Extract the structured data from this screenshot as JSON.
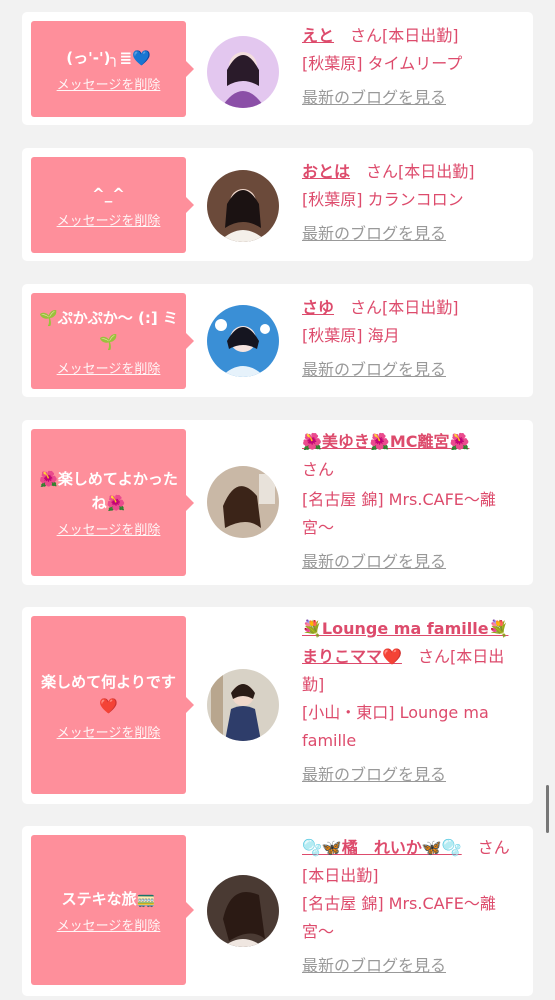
{
  "common": {
    "delete_label": "メッセージを削除",
    "blog_label": "最新のブログを見る",
    "san": "さん"
  },
  "items": [
    {
      "message": "(っ'-')╮≣💙",
      "name": "えと",
      "status": "[本日出勤]",
      "shop": "[秋葉原] タイムリープ"
    },
    {
      "message": "^_^",
      "name": "おとは",
      "status": "[本日出勤]",
      "shop": "[秋葉原] カランコロン"
    },
    {
      "message": "🌱ぷかぷか〜 (:] ミ🌱",
      "name": "さゆ",
      "status": "[本日出勤]",
      "shop": "[秋葉原] 海月"
    },
    {
      "message": "🌺楽しめてよかったね🌺",
      "name": "🌺美ゆき🌺MC離宮🌺",
      "status": "",
      "shop": "[名古屋 錦] Mrs.CAFE〜離宮〜"
    },
    {
      "message": "楽しめて何よりです❤️",
      "name": "💐Lounge ma famille💐まりこママ❤️",
      "status": "[本日出勤]",
      "shop": "[小山・東口] Lounge ma famille"
    },
    {
      "message": "ステキな旅🚃",
      "name": "🫧🦋橘　れいか🦋🫧",
      "status": "[本日出勤]",
      "shop": "[名古屋 錦] Mrs.CAFE〜離宮〜"
    }
  ],
  "colors": {
    "bubble": "#fe8f9b",
    "accent": "#dd4b6c",
    "blog_link": "#999999",
    "background": "#f2f2f2"
  }
}
